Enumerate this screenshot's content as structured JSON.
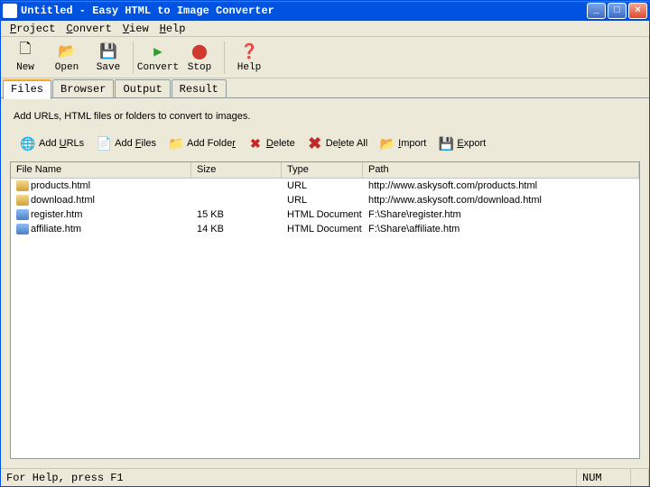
{
  "title": "Untitled - Easy HTML to Image Converter",
  "menu": {
    "items": [
      "Project",
      "Convert",
      "View",
      "Help"
    ]
  },
  "toolbar": {
    "new": "New",
    "open": "Open",
    "save": "Save",
    "convert": "Convert",
    "stop": "Stop",
    "help": "Help"
  },
  "tabs": {
    "items": [
      "Files",
      "Browser",
      "Output",
      "Result"
    ],
    "active": "Files"
  },
  "hint": "Add URLs, HTML files or folders to convert to images.",
  "actions": {
    "add_urls": "Add URLs",
    "add_files": "Add Files",
    "add_folder": "Add Folder",
    "delete": "Delete",
    "delete_all": "Delete All",
    "import": "Import",
    "export": "Export"
  },
  "list": {
    "headers": {
      "name": "File Name",
      "size": "Size",
      "type": "Type",
      "path": "Path"
    },
    "rows": [
      {
        "icon": "url-icon",
        "name": "products.html",
        "size": "",
        "type": "URL",
        "path": "http://www.askysoft.com/products.html"
      },
      {
        "icon": "url-icon",
        "name": "download.html",
        "size": "",
        "type": "URL",
        "path": "http://www.askysoft.com/download.html"
      },
      {
        "icon": "htm-icon",
        "name": "register.htm",
        "size": "15 KB",
        "type": "HTML Document",
        "path": "F:\\Share\\register.htm"
      },
      {
        "icon": "htm-icon",
        "name": "affiliate.htm",
        "size": "14 KB",
        "type": "HTML Document",
        "path": "F:\\Share\\affiliate.htm"
      }
    ]
  },
  "status": {
    "main": "For Help, press F1",
    "num": "NUM"
  }
}
